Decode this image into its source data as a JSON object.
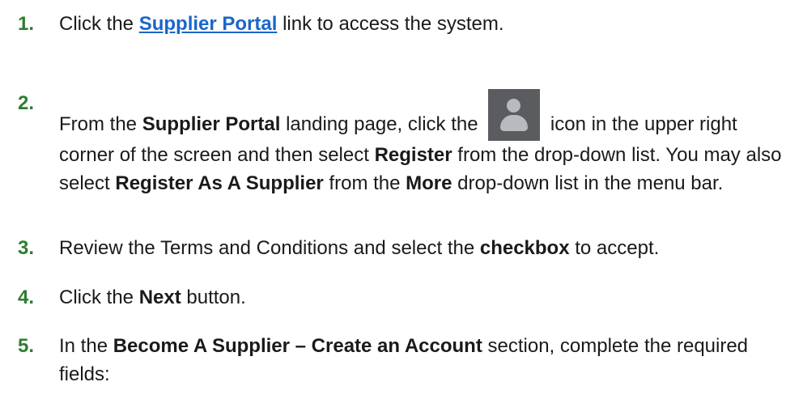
{
  "steps": [
    {
      "number": "1.",
      "parts": [
        {
          "t": "Click the "
        },
        {
          "t": "Supplier Portal",
          "link": true
        },
        {
          "t": " link to access the system."
        }
      ]
    },
    {
      "number": "2.",
      "icon": "user-avatar-icon",
      "parts": [
        {
          "t": "From the "
        },
        {
          "t": "Supplier Portal",
          "b": true
        },
        {
          "t": " landing page, click the "
        },
        {
          "icon": true
        },
        {
          "t": " icon in the upper right corner of the screen and then select "
        },
        {
          "t": "Register",
          "b": true
        },
        {
          "t": " from the drop-down list. You may also select "
        },
        {
          "t": "Register As A Supplier",
          "b": true
        },
        {
          "t": " from the "
        },
        {
          "t": "More",
          "b": true
        },
        {
          "t": " drop-down list in the menu bar."
        }
      ]
    },
    {
      "number": "3.",
      "parts": [
        {
          "t": "Review the Terms and Conditions and select the "
        },
        {
          "t": "checkbox",
          "b": true
        },
        {
          "t": " to accept."
        }
      ]
    },
    {
      "number": "4.",
      "parts": [
        {
          "t": "Click the "
        },
        {
          "t": "Next",
          "b": true
        },
        {
          "t": " button."
        }
      ]
    },
    {
      "number": "5.",
      "parts": [
        {
          "t": "In the "
        },
        {
          "t": "Become A Supplier – Create an Account",
          "b": true
        },
        {
          "t": " section, complete the required fields:"
        }
      ]
    }
  ],
  "colors": {
    "number": "#2e7d32",
    "link": "#1a66c9",
    "icon_bg": "#5a5c60"
  }
}
